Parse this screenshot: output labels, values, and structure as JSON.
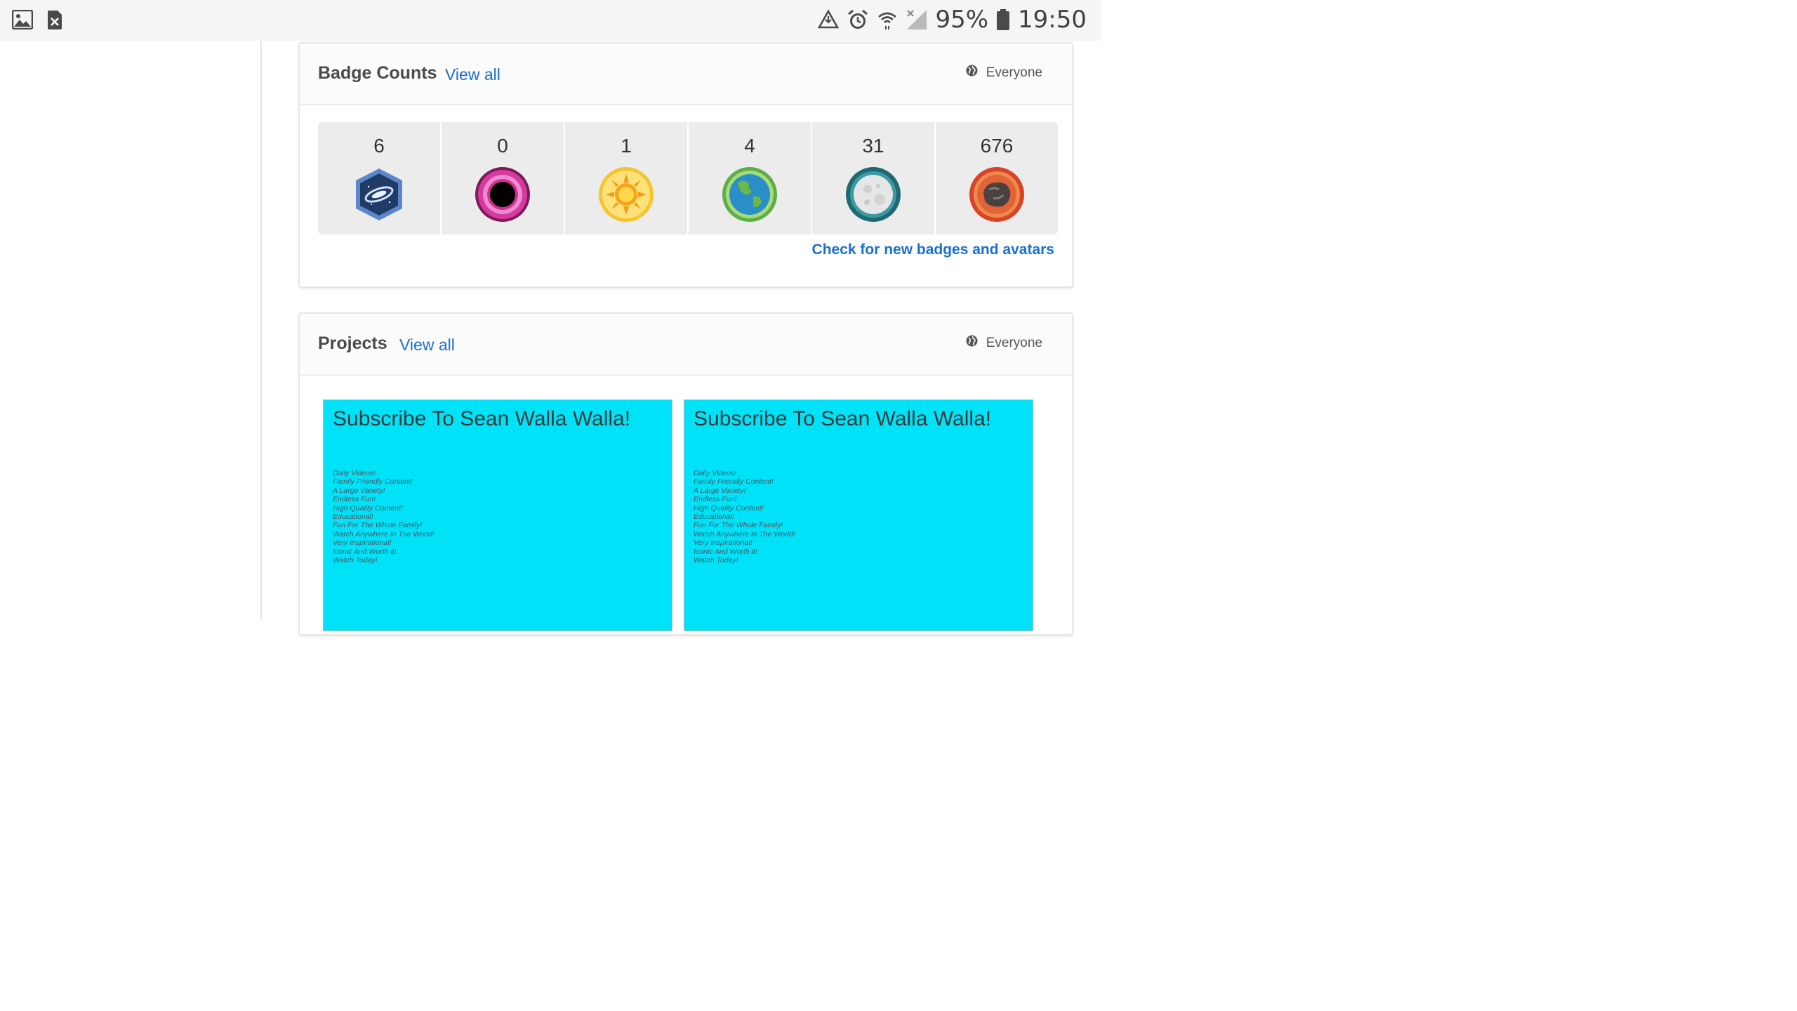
{
  "status_bar": {
    "left_icons": [
      "gallery-icon",
      "close-notification-icon"
    ],
    "right_icons": [
      "data-saver-icon",
      "alarm-icon",
      "wifi-icon",
      "signal-icon",
      "battery-icon"
    ],
    "battery_percent": "95%",
    "time": "19:50"
  },
  "badges_card": {
    "title": "Badge Counts",
    "view_all_label": "View all",
    "visibility_label": "Everyone",
    "visibility_icon": "globe-icon",
    "badges": [
      {
        "count": "6",
        "icon": "galaxy-badge-icon"
      },
      {
        "count": "0",
        "icon": "black-hole-badge-icon"
      },
      {
        "count": "1",
        "icon": "sun-badge-icon"
      },
      {
        "count": "4",
        "icon": "earth-badge-icon"
      },
      {
        "count": "31",
        "icon": "moon-badge-icon"
      },
      {
        "count": "676",
        "icon": "meteorite-badge-icon"
      }
    ],
    "check_link_label": "Check for new badges and avatars"
  },
  "projects_card": {
    "title": "Projects",
    "view_all_label": "View all",
    "visibility_label": "Everyone",
    "visibility_icon": "globe-icon",
    "projects": [
      {
        "thumb_title": "Subscribe To Sean Walla Walla!",
        "thumb_lines": [
          "Daily Videos!",
          "Family Friendly Content!",
          "A Large Variety!",
          "Endless Fun!",
          "High Quality Content!",
          "Educational!",
          "Fun For The Whole Family!",
          "Watch Anywhere In The World!",
          "Very Inspirational!",
          "Iconic And Worth it!",
          "Watch Today!"
        ]
      },
      {
        "thumb_title": "Subscribe To Sean Walla Walla!",
        "thumb_lines": [
          "Daily Videos!",
          "Family Friendly Content!",
          "A Large Variety!",
          "Endless Fun!",
          "High Quality Content!",
          "Educational!",
          "Fun For The Whole Family!",
          "Watch Anywhere In The World!",
          "Very Inspirational!",
          "Iconic And Worth it!",
          "Watch Today!"
        ]
      }
    ]
  },
  "colors": {
    "link": "#1a6fd1",
    "thumb_bg": "#00e2f8",
    "badge_cell_bg": "#ececec"
  }
}
